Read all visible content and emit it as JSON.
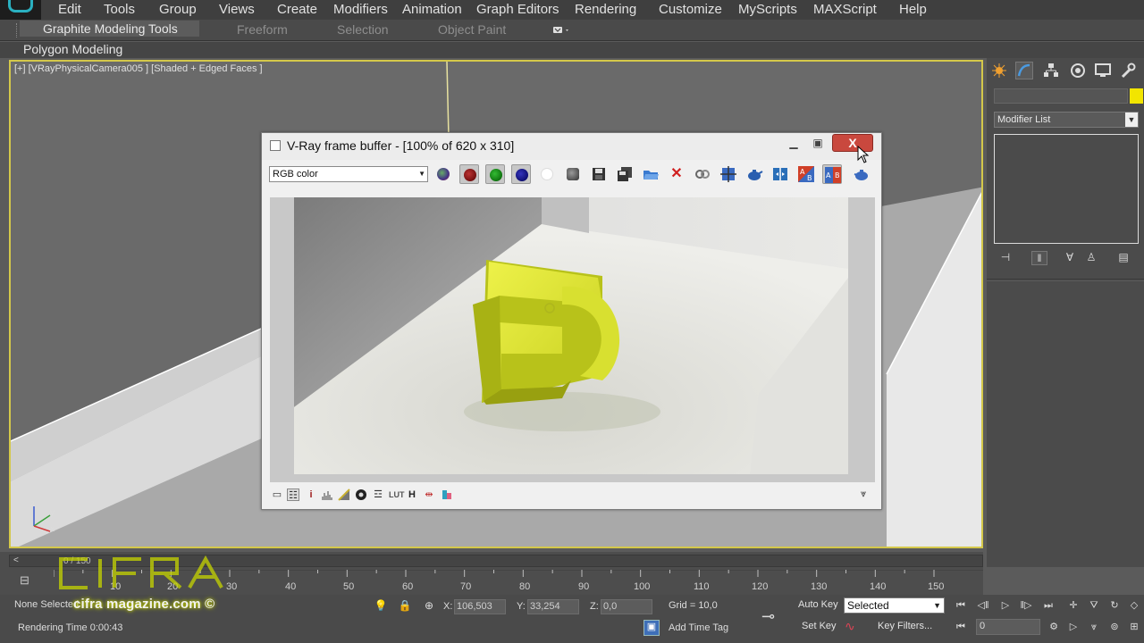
{
  "menubar": {
    "items": [
      "Edit",
      "Tools",
      "Group",
      "Views",
      "Create",
      "Modifiers",
      "Animation",
      "Graph Editors",
      "Rendering",
      "Customize",
      "MyScripts",
      "MAXScript",
      "Help"
    ]
  },
  "ribbon": {
    "tabs": [
      "Graphite Modeling Tools",
      "Freeform",
      "Selection",
      "Object Paint"
    ],
    "active_tab": "Graphite Modeling Tools",
    "panel_label": "Polygon Modeling"
  },
  "viewport": {
    "label": "[+] [VRayPhysicalCamera005 ] [Shaded + Edged Faces ]",
    "border_color": "#d4c84a",
    "axis_labels": [
      "z",
      "y",
      "x"
    ]
  },
  "command_panel": {
    "tab_icons": [
      "create-icon",
      "modify-icon",
      "hierarchy-icon",
      "motion-icon",
      "display-icon",
      "utilities-icon"
    ],
    "name_value": "",
    "object_color": "#f2e500",
    "modifier_list_label": "Modifier List"
  },
  "frame_buffer": {
    "title": "V-Ray frame buffer - [100% of 620 x 310]",
    "channel": "RGB color",
    "render_width": 620,
    "render_height": 310,
    "close_glyph": "X",
    "toolbar_icons": [
      "color-channels-icon",
      "red-channel-icon",
      "green-channel-icon",
      "blue-channel-icon",
      "alpha-channel-icon",
      "mono-icon",
      "save-icon",
      "save-all-icon",
      "load-icon",
      "clear-icon",
      "link-icon",
      "region-render-icon",
      "render-last-icon",
      "compare-icon",
      "ab-compare-icon",
      "ab-horizontal-icon",
      "render-teapot-icon"
    ],
    "bottom_icons": [
      "display-color-icon",
      "lut-list-icon",
      "info-icon",
      "histogram-icon",
      "levels-icon",
      "curve-icon",
      "exposure-icon",
      "lut-icon",
      "hsv-icon",
      "srgb-icon",
      "ocio-icon"
    ],
    "bottom_glyphs": {
      "info": "i",
      "lut": "LUT",
      "hsv": "H"
    }
  },
  "timeline": {
    "slider_label": "0 / 150",
    "ticks": [
      "10",
      "20",
      "30",
      "40",
      "50",
      "60",
      "70",
      "80",
      "90",
      "100",
      "110",
      "120",
      "130",
      "140",
      "150"
    ]
  },
  "statusbar": {
    "selection": "None Selected",
    "render_time": "Rendering Time  0:00:43",
    "x_label": "X:",
    "x_value": "106,503",
    "y_label": "Y:",
    "y_value": "33,254",
    "z_label": "Z:",
    "z_value": "0,0",
    "grid": "Grid = 10,0",
    "add_time_tag": "Add Time Tag",
    "auto_key": "Auto Key",
    "set_key": "Set Key",
    "key_mode": "Selected",
    "key_filters": "Key Filters...",
    "frame": "0"
  },
  "watermark": {
    "logo_text": "CIFRA",
    "site": "cifra magazine.com ©"
  }
}
